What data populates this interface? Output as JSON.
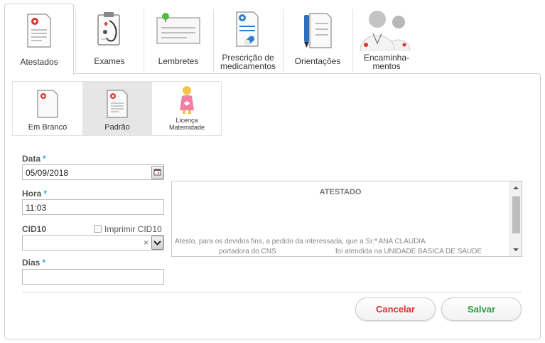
{
  "tabs": [
    {
      "label": "Atestados",
      "icon": "certificate-icon"
    },
    {
      "label": "Exames",
      "icon": "clipboard-stethoscope-icon"
    },
    {
      "label": "Lembretes",
      "icon": "note-pin-icon"
    },
    {
      "label": "Prescrição de\nmedicamentos",
      "icon": "prescription-icon"
    },
    {
      "label": "Orientações",
      "icon": "pen-document-icon"
    },
    {
      "label": "Encaminha-\nmentos",
      "icon": "doctors-icon"
    }
  ],
  "types": [
    {
      "label": "Em Branco",
      "icon": "blank-document-icon"
    },
    {
      "label": "Padrão",
      "icon": "standard-document-icon"
    },
    {
      "label": "Licença\nMaternidade",
      "icon": "pregnant-woman-icon"
    }
  ],
  "form": {
    "data_label": "Data",
    "data_value": "05/09/2018",
    "hora_label": "Hora",
    "hora_value": "11:03",
    "cid_label": "CID10",
    "print_cid_label": "Imprimir CID10",
    "cid_clear": "×",
    "dias_label": "Dias",
    "required_mark": "*"
  },
  "document": {
    "title": "ATESTADO",
    "line1": "Atesto, para os devidos fins, a pedido da interessada, que a Sr.ª ANA CLAUDIA",
    "line2": "portadora do CNS                              foi atendida na UNIDADE BASICA DE SAUDE"
  },
  "buttons": {
    "cancel": "Cancelar",
    "save": "Salvar"
  },
  "colors": {
    "required": "#2fa6e0",
    "cancel": "#d9332e",
    "save": "#2a9a3a",
    "selected_bg": "#e6e6e6"
  }
}
